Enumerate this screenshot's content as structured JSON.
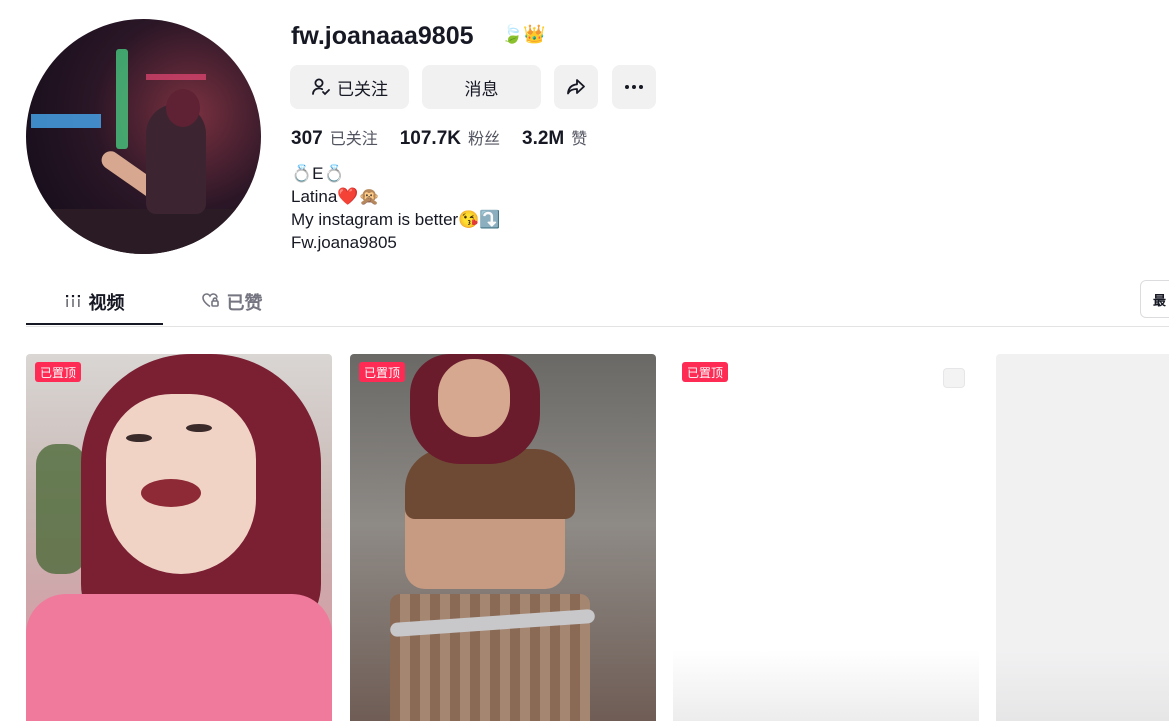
{
  "profile": {
    "username": "fw.joanaaa9805",
    "badges": "🍃👑",
    "buttons": {
      "following": "已关注",
      "message": "消息"
    },
    "stats": [
      {
        "value": "307",
        "label": "已关注"
      },
      {
        "value": "107.7K",
        "label": "粉丝"
      },
      {
        "value": "3.2M",
        "label": "赞"
      }
    ],
    "bio": [
      "💍E💍",
      "Latina❤️🙊",
      "My instagram is better😘⤵️",
      "Fw.joana9805"
    ]
  },
  "tabs": {
    "videos": "视频",
    "liked": "已赞",
    "sort": "最"
  },
  "videos": [
    {
      "pin_label": "已置顶"
    },
    {
      "pin_label": "已置顶"
    },
    {
      "pin_label": "已置顶"
    },
    {}
  ],
  "colors": {
    "accent": "#fe2c55",
    "button_bg": "#f1f1f2",
    "text_primary": "#161823",
    "text_secondary": "#525460"
  }
}
